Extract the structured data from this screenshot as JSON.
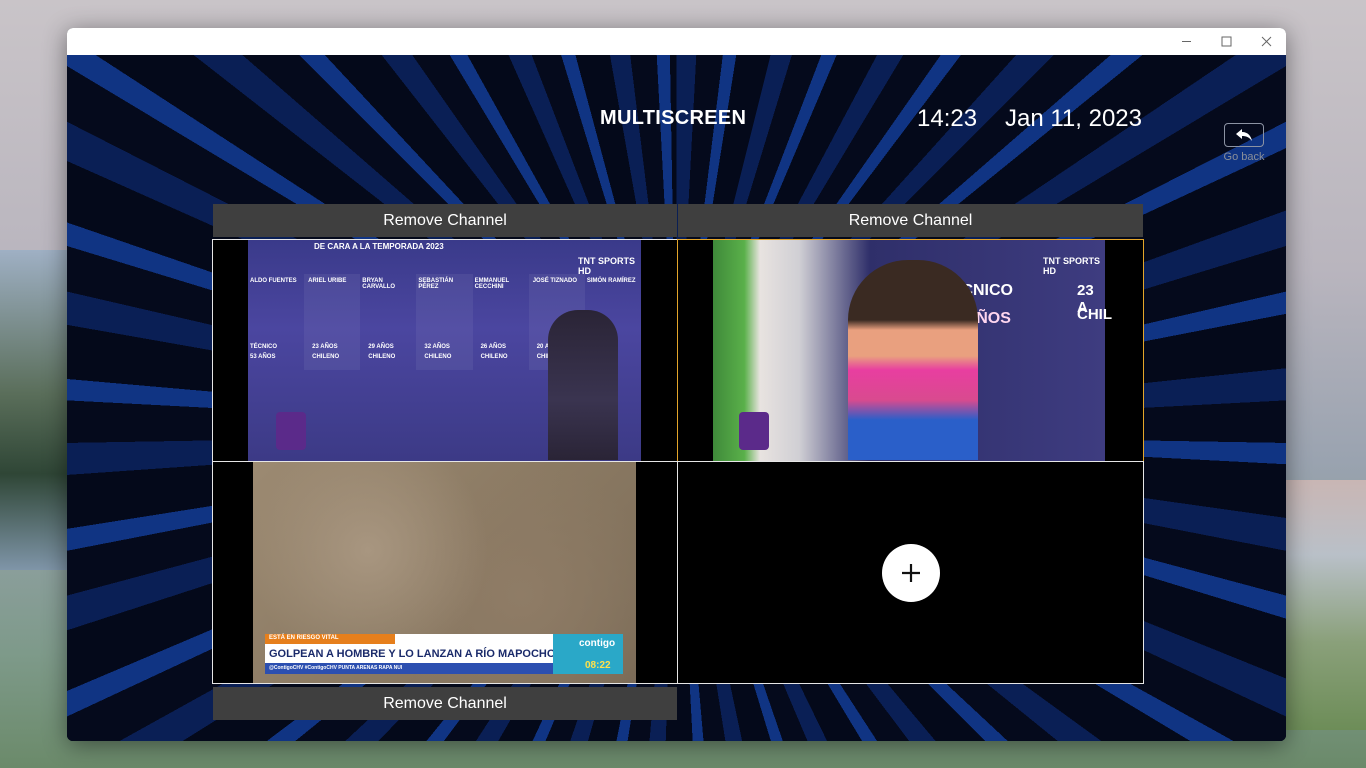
{
  "window": {
    "minimize_icon": "minimize-icon",
    "maximize_icon": "maximize-icon",
    "close_icon": "close-icon"
  },
  "header": {
    "title": "MULTISCREEN",
    "time": "14:23",
    "date": "Jan 11, 2023",
    "go_back_label": "Go back",
    "go_back_icon": "reply-arrow-icon"
  },
  "slots": [
    {
      "remove_label": "Remove Channel",
      "overlay": {
        "banner_top": "DE CARA A LA TEMPORADA 2023",
        "logo": "TNT SPORTS HD",
        "players": [
          {
            "name": "ALDO FUENTES",
            "info": "TÉCNICO",
            "age": "53 AÑOS"
          },
          {
            "name": "ARIEL URIBE",
            "info": "23 AÑOS",
            "age": "CHILENO"
          },
          {
            "name": "BRYAN CARVALLO",
            "info": "29 AÑOS",
            "age": "CHILENO"
          },
          {
            "name": "SEBASTIÁN PÉREZ",
            "info": "32 AÑOS",
            "age": "CHILENO"
          },
          {
            "name": "EMMANUEL CECCHINI",
            "info": "26 AÑOS",
            "age": "CHILENO"
          },
          {
            "name": "JOSÉ TIZNADO",
            "info": "20 AÑOS",
            "age": "CHILENO"
          },
          {
            "name": "SIMÓN RAMÍREZ",
            "info": "",
            "age": ""
          }
        ]
      }
    },
    {
      "remove_label": "Remove Channel",
      "overlay": {
        "label1": "TÉCNICO",
        "label2": "53 AÑOS",
        "label3": "23 A",
        "label4": "CHIL",
        "logo": "TNT SPORTS HD"
      }
    },
    {
      "remove_label": "Remove Channel",
      "overlay": {
        "tag": "ESTÁ EN RIESGO VITAL",
        "headline": "GOLPEAN A HOMBRE Y LO LANZAN A RÍO MAPOCHO",
        "ticker": "@ContigoCHV  #ContigoCHV  PUNTA ARENAS  RAPA NUI",
        "brand": "contigo",
        "time": "08:22"
      }
    },
    {
      "add_icon": "plus-icon"
    }
  ],
  "colors": {
    "accent_border": "#e3a52a",
    "bar_bg": "#3f3f3f"
  }
}
